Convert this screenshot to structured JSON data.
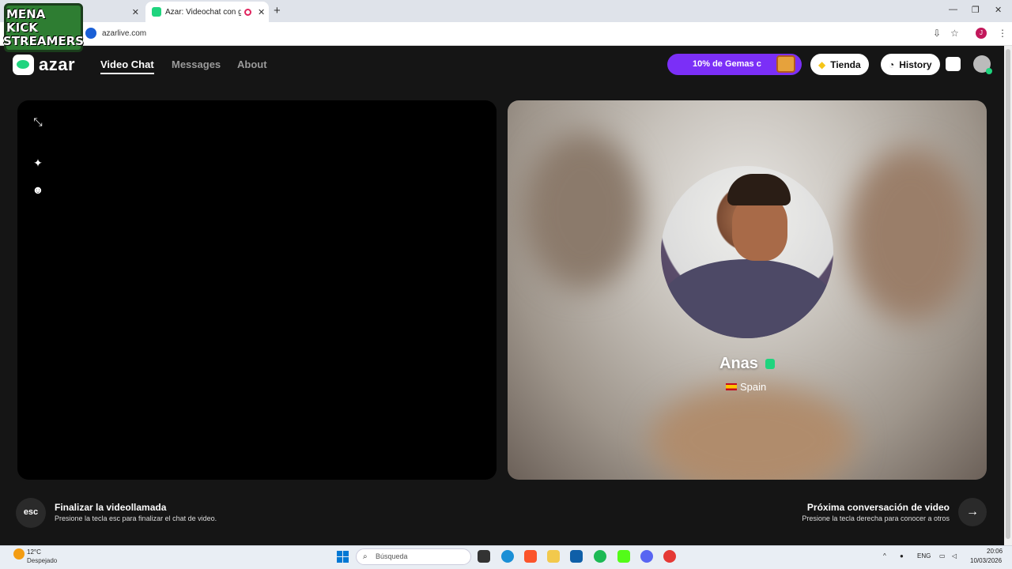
{
  "browser": {
    "tabs": [
      {
        "title": ""
      },
      {
        "title": "Azar: Videochat con gente"
      }
    ],
    "new_tab_label": "+",
    "close_glyph": "✕",
    "url": "azarlive.com",
    "profile_initial": "J"
  },
  "overlay": {
    "line1": "MENA KICK",
    "line2": "STREAMERS"
  },
  "app": {
    "brand": "azar",
    "nav": {
      "video_chat": "Video Chat",
      "messages": "Messages",
      "about": "About"
    },
    "promo": "10% de Gemas c",
    "store": "Tienda",
    "history": "History"
  },
  "peer": {
    "name": "Anas",
    "country": "Spain"
  },
  "controls": {
    "esc_key": "esc",
    "end_title": "Finalizar la videollamada",
    "end_sub": "Presione la tecla esc para finalizar el chat de video.",
    "next_title": "Próxima conversación de video",
    "next_sub": "Presione la tecla derecha para conocer a otros",
    "next_glyph": "→"
  },
  "taskbar": {
    "weather_temp": "12°C",
    "weather_desc": "Despejado",
    "search_placeholder": "Búsqueda",
    "lang": "ENG",
    "time": "20:06",
    "date": "10/03/2026"
  },
  "colors": {
    "accent": "#1fd47e",
    "promo": "#7b2ff7",
    "app_bg": "#151515"
  }
}
